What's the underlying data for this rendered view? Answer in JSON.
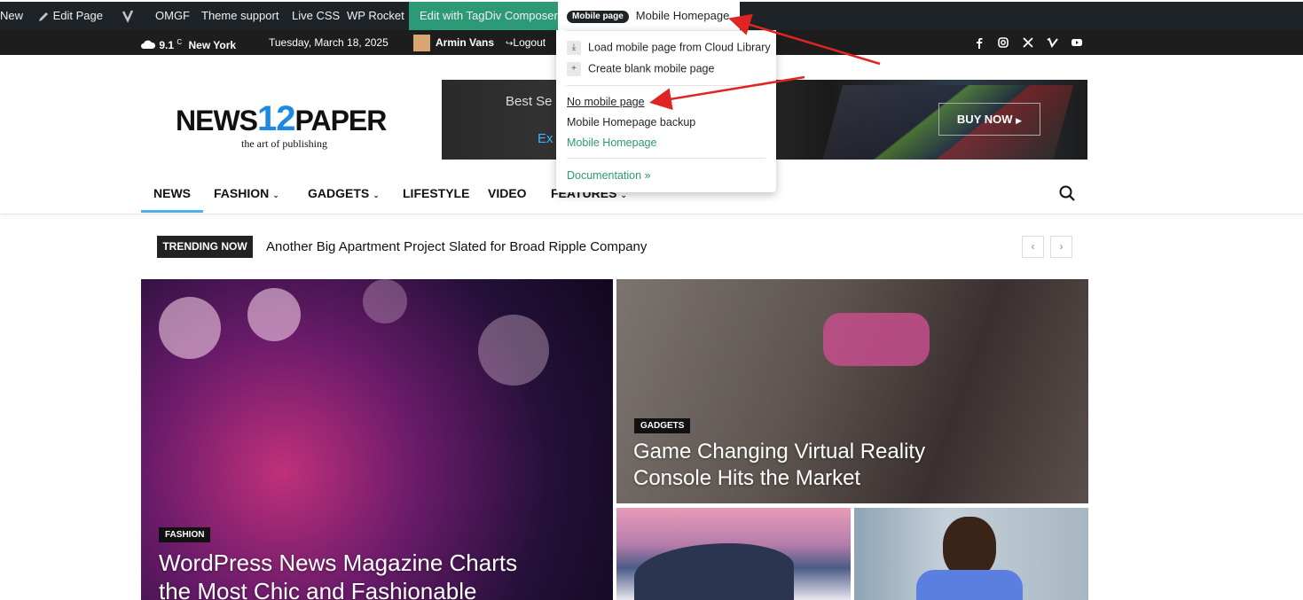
{
  "admin_bar": {
    "new": "New",
    "edit_page": "Edit Page",
    "omgf": "OMGF",
    "theme_support": "Theme support",
    "live_css": "Live CSS",
    "wp_rocket": "WP Rocket",
    "tagdiv": "Edit with TagDiv Composer",
    "mobile_badge": "Mobile page",
    "mobile_current": "Mobile Homepage"
  },
  "top_bar": {
    "temperature": "9.1",
    "unit": "C",
    "city": "New York",
    "date": "Tuesday, March 18, 2025",
    "user": "Armin Vans",
    "logout": "Logout",
    "social_icons": [
      "facebook-icon",
      "instagram-icon",
      "x-icon",
      "vimeo-icon",
      "youtube-icon"
    ]
  },
  "logo": {
    "left": "NEWS",
    "num": "12",
    "right": "PAPER",
    "tagline": "the art of publishing"
  },
  "banner": {
    "line1": "Best Se",
    "line2": "Ex",
    "buy": "BUY NOW"
  },
  "nav": {
    "items": [
      {
        "label": "NEWS"
      },
      {
        "label": "FASHION"
      },
      {
        "label": "GADGETS"
      },
      {
        "label": "LIFESTYLE"
      },
      {
        "label": "VIDEO"
      },
      {
        "label": "FEATURES"
      }
    ]
  },
  "trending": {
    "label": "TRENDING NOW",
    "headline": "Another Big Apartment Project Slated for Broad Ripple Company"
  },
  "cards": [
    {
      "category": "FASHION",
      "title_line1": "WordPress News Magazine Charts",
      "title_line2": "the Most Chic and Fashionable"
    },
    {
      "category": "GADGETS",
      "title_line1": "Game Changing Virtual Reality",
      "title_line2": "Console Hits the Market"
    }
  ],
  "dropdown": {
    "load_cloud": "Load mobile page from Cloud Library",
    "create_blank": "Create blank mobile page",
    "no_mobile": "No mobile page",
    "backup": "Mobile Homepage backup",
    "homepage": "Mobile Homepage",
    "docs": "Documentation »"
  },
  "colors": {
    "accent": "#4db2ec",
    "tagdiv_green": "#2c9a76",
    "admin_bar": "#1d2327",
    "arrow": "#e02424"
  }
}
